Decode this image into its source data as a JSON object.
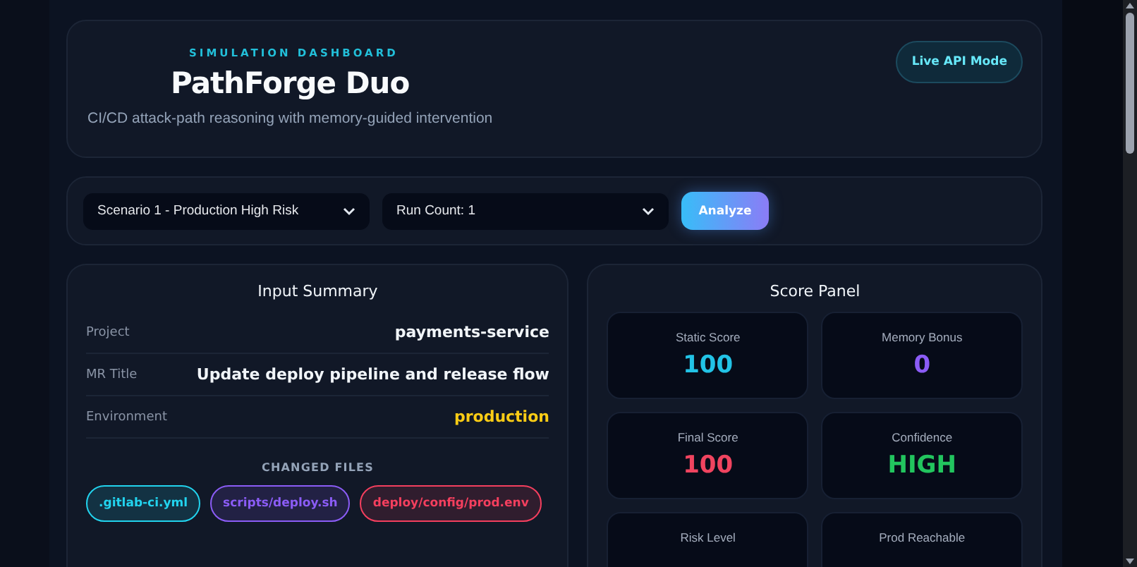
{
  "header": {
    "eyebrow": "SIMULATION DASHBOARD",
    "title": "PathForge Duo",
    "subtitle": "CI/CD attack-path reasoning with memory-guided intervention",
    "mode_badge": "Live API Mode"
  },
  "controls": {
    "scenario": "Scenario 1 - Production High Risk",
    "run_count": "Run Count: 1",
    "analyze_button": "Analyze"
  },
  "input_summary": {
    "title": "Input Summary",
    "fields": [
      {
        "label": "Project",
        "value": "payments-service",
        "color": "#f1f5f9"
      },
      {
        "label": "MR Title",
        "value": "Update deploy pipeline and release flow",
        "color": "#f1f5f9"
      },
      {
        "label": "Environment",
        "value": "production",
        "color": "#facc15"
      }
    ],
    "changed_files_title": "CHANGED FILES",
    "changed_files": [
      {
        "name": ".gitlab-ci.yml",
        "color": "#22d3ee"
      },
      {
        "name": "scripts/deploy.sh",
        "color": "#8b5cf6"
      },
      {
        "name": "deploy/config/prod.env",
        "color": "#f43f5e"
      }
    ]
  },
  "score_panel": {
    "title": "Score Panel",
    "metrics": [
      {
        "label": "Static Score",
        "value": "100",
        "color": "#22c3e6"
      },
      {
        "label": "Memory Bonus",
        "value": "0",
        "color": "#8b5cf6"
      },
      {
        "label": "Final Score",
        "value": "100",
        "color": "#f0445f"
      },
      {
        "label": "Confidence",
        "value": "HIGH",
        "color": "#22c55e"
      },
      {
        "label": "Risk Level"
      },
      {
        "label": "Prod Reachable"
      }
    ]
  }
}
